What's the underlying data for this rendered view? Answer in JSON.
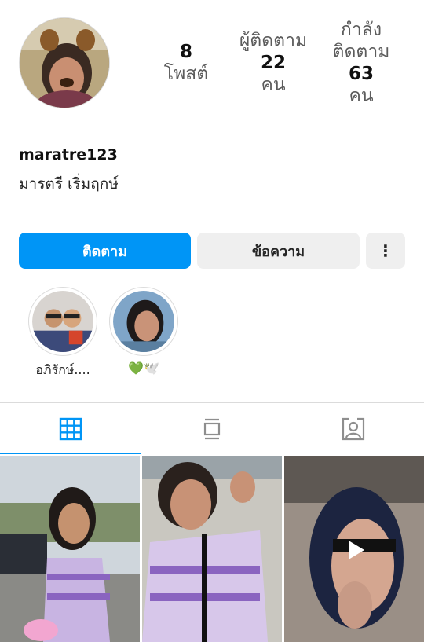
{
  "profile": {
    "username": "maratre123",
    "full_name": "มารตรี เริ่มฤกษ์"
  },
  "stats": {
    "posts": {
      "count": "8",
      "label": "โพสต์"
    },
    "followers": {
      "label": "ผู้ติดตาม",
      "count": "22",
      "unit": "คน"
    },
    "following": {
      "label_line1": "กำลัง",
      "label_line2": "ติดตาม",
      "count": "63",
      "unit": "คน"
    }
  },
  "actions": {
    "follow_label": "ติดตาม",
    "message_label": "ข้อความ",
    "more_label": "⋮"
  },
  "highlights": [
    {
      "caption": "อภิรักษ์...."
    },
    {
      "caption": "💚🕊️"
    }
  ],
  "tabs": [
    {
      "name": "grid",
      "icon": "grid-icon",
      "active": true
    },
    {
      "name": "feed",
      "icon": "feed-icon",
      "active": false
    },
    {
      "name": "tagged",
      "icon": "tagged-person-icon",
      "active": false
    }
  ],
  "colors": {
    "accent": "#0095f6",
    "button_gray": "#efefef",
    "divider": "#dbdbdb",
    "text": "#262626"
  }
}
